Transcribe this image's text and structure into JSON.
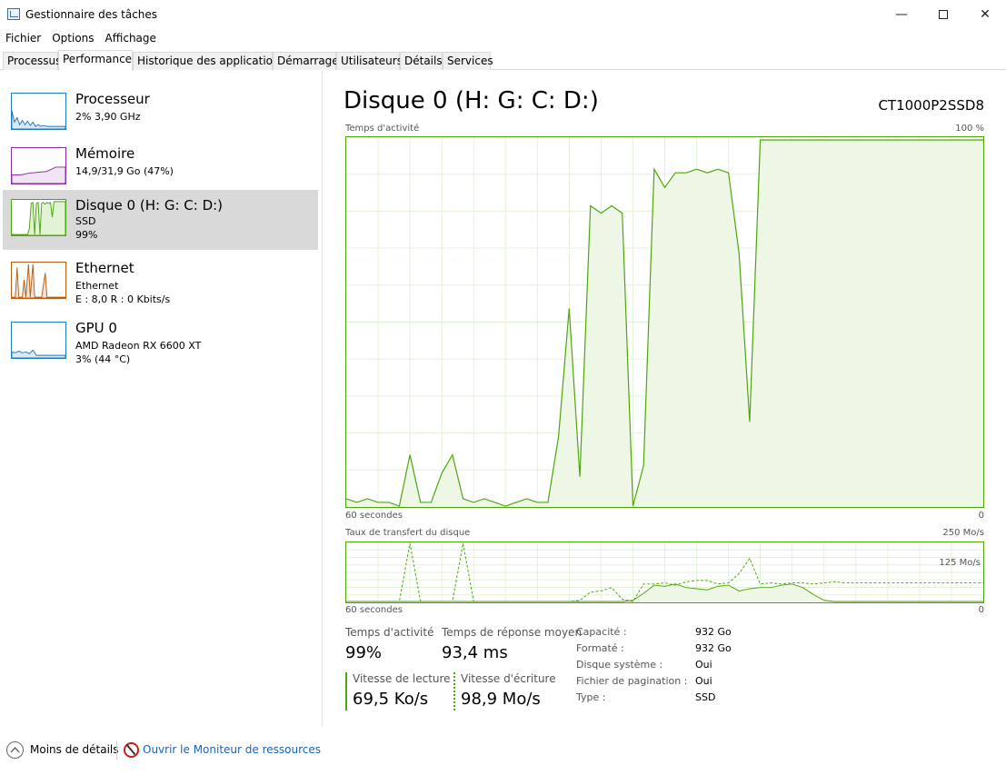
{
  "window": {
    "title": "Gestionnaire des tâches",
    "min_glyph": "—",
    "close_glyph": "✕"
  },
  "menu": [
    "Fichier",
    "Options",
    "Affichage"
  ],
  "tabs": [
    "Processus",
    "Performance",
    "Historique des applications",
    "Démarrage",
    "Utilisateurs",
    "Détails",
    "Services"
  ],
  "active_tab": "Performance",
  "sidebar": {
    "items": [
      {
        "name": "Processeur",
        "line1": "2% 3,90 GHz",
        "line2": "",
        "color": "#1e7bbf"
      },
      {
        "name": "Mémoire",
        "line1": "14,9/31,9 Go (47%)",
        "line2": "",
        "color": "#8b2e9f"
      },
      {
        "name": "Disque 0 (H: G: C: D:)",
        "line1": "SSD",
        "line2": "99%",
        "color": "#4da60c"
      },
      {
        "name": "Ethernet",
        "line1": "Ethernet",
        "line2": "E : 8,0  R : 0 Kbits/s",
        "color": "#b85e16"
      },
      {
        "name": "GPU 0",
        "line1": "AMD Radeon RX 6600 XT",
        "line2": "3% (44 °C)",
        "color": "#1e7bbf"
      }
    ],
    "selected_index": 2
  },
  "detail": {
    "title": "Disque 0 (H: G: C: D:)",
    "model": "CT1000P2SSD8",
    "activity_chart": {
      "label": "Temps d'activité",
      "max_label": "100 %",
      "x_left": "60 secondes",
      "x_right": "0"
    },
    "transfer_chart": {
      "label": "Taux de transfert du disque",
      "max_label": "250 Mo/s",
      "mid_label": "125 Mo/s",
      "x_left": "60 secondes",
      "x_right": "0"
    },
    "stats": {
      "active_time_label": "Temps d'activité",
      "active_time_value": "99%",
      "response_label": "Temps de réponse moyen",
      "response_value": "93,4 ms",
      "read_label": "Vitesse de lecture",
      "read_value": "69,5 Ko/s",
      "write_label": "Vitesse d'écriture",
      "write_value": "98,9 Mo/s"
    },
    "properties": [
      {
        "key": "Capacité :",
        "value": "932 Go"
      },
      {
        "key": "Formaté :",
        "value": "932 Go"
      },
      {
        "key": "Disque système :",
        "value": "Oui"
      },
      {
        "key": "Fichier de pagination :",
        "value": "Oui"
      },
      {
        "key": "Type :",
        "value": "SSD"
      }
    ]
  },
  "bottom": {
    "less_details": "Moins de détails",
    "open_monitor": "Ouvrir le Moniteur de ressources"
  },
  "chart_data": [
    {
      "type": "area",
      "title": "Temps d'activité",
      "xlabel": "60 secondes",
      "x": [
        60,
        59,
        58,
        57,
        56,
        55,
        54,
        53,
        52,
        51,
        50,
        49,
        48,
        47,
        46,
        45,
        44,
        43,
        42,
        41,
        40,
        39,
        38,
        37,
        36,
        35,
        34,
        33,
        32,
        31,
        30,
        29,
        28,
        27,
        26,
        25,
        24,
        23,
        22,
        21,
        20,
        19,
        18,
        17,
        16,
        15,
        14,
        13,
        12,
        11,
        10,
        9,
        8,
        7,
        6,
        5,
        4,
        3,
        2,
        1,
        0
      ],
      "values": [
        2,
        1,
        2,
        1,
        1,
        0,
        14,
        1,
        1,
        9,
        14,
        2,
        1,
        2,
        1,
        0,
        1,
        2,
        1,
        1,
        19,
        54,
        8,
        82,
        80,
        82,
        80,
        0,
        11,
        92,
        87,
        91,
        91,
        92,
        91,
        92,
        91,
        69,
        23,
        100,
        100,
        100,
        100,
        100,
        100,
        100,
        100,
        100,
        100,
        100,
        100,
        100,
        100,
        100,
        100,
        100,
        100,
        100,
        100,
        100,
        100
      ],
      "ylim": [
        0,
        100
      ],
      "color": "#4da60c"
    },
    {
      "type": "line",
      "title": "Taux de transfert du disque",
      "xlabel": "60 secondes",
      "ylim": [
        0,
        250
      ],
      "series": [
        {
          "style": "solid",
          "values": [
            0,
            0,
            0,
            0,
            0,
            0,
            0,
            0,
            0,
            0,
            0,
            0,
            0,
            0,
            0,
            0,
            0,
            0,
            0,
            0,
            0,
            0,
            0,
            0,
            0,
            0,
            0,
            5,
            35,
            70,
            65,
            75,
            60,
            55,
            50,
            65,
            70,
            45,
            55,
            60,
            60,
            70,
            75,
            60,
            30,
            5,
            0,
            0,
            0,
            0,
            0,
            0,
            0,
            0,
            0,
            0,
            0,
            0,
            0,
            0,
            0
          ]
        },
        {
          "style": "dotted",
          "values": [
            0,
            0,
            0,
            0,
            0,
            0,
            250,
            0,
            0,
            0,
            0,
            250,
            0,
            0,
            0,
            0,
            0,
            0,
            0,
            0,
            0,
            0,
            5,
            40,
            45,
            60,
            10,
            0,
            75,
            75,
            80,
            70,
            85,
            90,
            90,
            75,
            80,
            120,
            185,
            75,
            80,
            75,
            80,
            80,
            75,
            80,
            85,
            80,
            80,
            80,
            80,
            80,
            80,
            80,
            80,
            80,
            80,
            80,
            80,
            80,
            80
          ]
        }
      ],
      "color": "#4da60c"
    }
  ]
}
